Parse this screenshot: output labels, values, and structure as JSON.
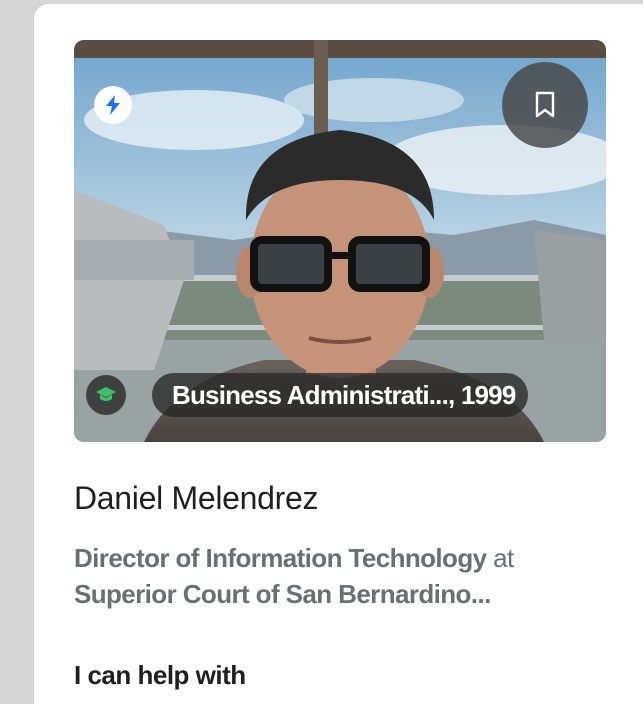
{
  "profile": {
    "name": "Daniel Melendrez",
    "role": "Director of Information Technology",
    "connector": "at",
    "company": "Superior Court of San Bernardino...",
    "education": "Business Administrati..., 1999",
    "help_heading": "I can help with"
  },
  "icons": {
    "bolt": "lightning-bolt-icon",
    "bookmark": "bookmark-icon",
    "education": "graduation-cap-icon"
  },
  "colors": {
    "bolt_blue": "#1a73e8",
    "edu_green": "#3fc06b",
    "name_text": "#1f1f1f",
    "title_text": "#6b6f73"
  }
}
